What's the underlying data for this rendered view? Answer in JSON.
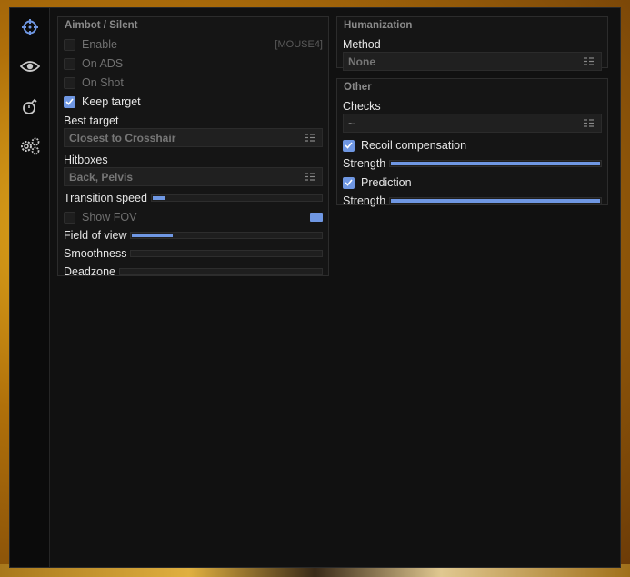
{
  "sidebar": {
    "items": [
      {
        "icon": "crosshair-icon",
        "active": true
      },
      {
        "icon": "eye-icon",
        "active": false
      },
      {
        "icon": "grenade-icon",
        "active": false
      },
      {
        "icon": "gears-icon",
        "active": false
      }
    ]
  },
  "aimbot": {
    "title": "Aimbot / Silent",
    "enable": {
      "label": "Enable",
      "checked": false,
      "keybind": "[MOUSE4]"
    },
    "on_ads": {
      "label": "On ADS",
      "checked": false
    },
    "on_shot": {
      "label": "On Shot",
      "checked": false
    },
    "keep_target": {
      "label": "Keep target",
      "checked": true
    },
    "best_target": {
      "label": "Best target",
      "value": "Closest to Crosshair"
    },
    "hitboxes": {
      "label": "Hitboxes",
      "value": "Back, Pelvis"
    },
    "transition_speed": {
      "label": "Transition speed",
      "fraction": 0.08
    },
    "show_fov": {
      "label": "Show FOV",
      "checked": false
    },
    "field_of_view": {
      "label": "Field of view",
      "fraction": 0.22
    },
    "smoothness": {
      "label": "Smoothness",
      "fraction": 0.0
    },
    "deadzone": {
      "label": "Deadzone",
      "fraction": 0.0
    }
  },
  "humanization": {
    "title": "Humanization",
    "method": {
      "label": "Method",
      "value": "None"
    }
  },
  "other": {
    "title": "Other",
    "checks": {
      "label": "Checks",
      "value": "~"
    },
    "recoil": {
      "label": "Recoil compensation",
      "checked": true
    },
    "recoil_strength": {
      "label": "Strength",
      "fraction": 1.0
    },
    "prediction": {
      "label": "Prediction",
      "checked": true
    },
    "prediction_strength": {
      "label": "Strength",
      "fraction": 1.0
    }
  },
  "colors": {
    "accent": "#6f97e3",
    "bg": "#111111",
    "panel": "#151515"
  }
}
